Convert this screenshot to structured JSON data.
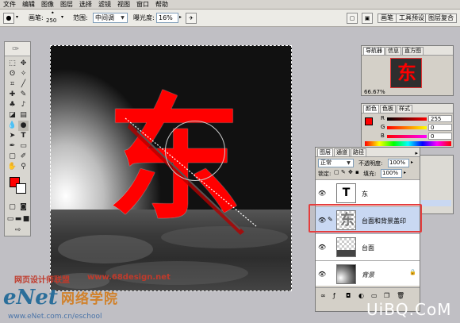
{
  "menu": [
    "文件",
    "编辑",
    "图像",
    "图层",
    "选择",
    "滤镜",
    "视图",
    "窗口",
    "帮助"
  ],
  "options": {
    "brush_label": "画笔:",
    "brush_size": "250",
    "range_label": "范围:",
    "range_value": "中间调",
    "exposure_label": "曝光度:",
    "exposure_value": "16%"
  },
  "panel_well": {
    "tabs": [
      "画笔",
      "工具预设",
      "图层复合"
    ]
  },
  "navigator": {
    "tabs": [
      "导航器",
      "信息",
      "直方图"
    ],
    "zoom": "66.67%"
  },
  "color_panel": {
    "tabs": [
      "颜色",
      "色板",
      "样式"
    ],
    "channels": [
      {
        "label": "R",
        "value": "255"
      },
      {
        "label": "G",
        "value": "0"
      },
      {
        "label": "B",
        "value": "0"
      }
    ],
    "fg_color": "#ff0000"
  },
  "layers_panel": {
    "tabs": [
      "图层",
      "通道",
      "路径"
    ],
    "blend_mode": "正常",
    "opacity_label": "不透明度:",
    "opacity_value": "100%",
    "lock_label": "锁定:",
    "fill_label": "填充:",
    "fill_value": "100%",
    "layers": [
      {
        "name": "东",
        "type": "text",
        "selected": false
      },
      {
        "name": "台面和背景盖印",
        "type": "pixel",
        "selected": true
      },
      {
        "name": "台面",
        "type": "pixel",
        "selected": false
      },
      {
        "name": "背景",
        "type": "background",
        "selected": false
      }
    ]
  },
  "canvas": {
    "text": "东",
    "text_color": "#ff0000"
  },
  "watermarks": {
    "site_cn": "网页设计师联盟",
    "site_url": "www.68design.net",
    "enet_logo": "eNet",
    "enet_cn": "网络学院",
    "enet_url": "www.eNet.com.cn/eschool",
    "uibq": "UiBQ.CoM"
  }
}
